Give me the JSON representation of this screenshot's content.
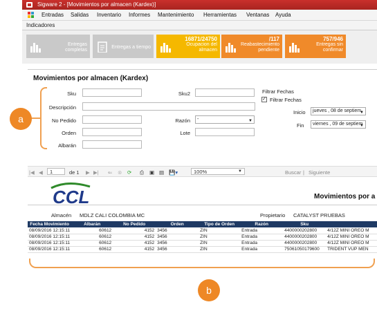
{
  "window": {
    "title": "Sigware 2 - [Movimientos por almacen (Kardex)]"
  },
  "menu": [
    "Entradas",
    "Salidas",
    "Inventario",
    "Informes",
    "Mantenimiento",
    "Herramientas",
    "Ventanas",
    "Ayuda"
  ],
  "subbar": {
    "label": "Indicadores"
  },
  "tiles": [
    {
      "num": "",
      "label1": "Entregas",
      "label2": "completas",
      "color": "#c9c9c9"
    },
    {
      "num": "",
      "label1": "Entregas a tiempo",
      "label2": "",
      "color": "#c9c9c9"
    },
    {
      "num": "16871/24750",
      "label1": "Ocupacion del",
      "label2": "almacen",
      "color": "#f5b800"
    },
    {
      "num": "/117",
      "label1": "Reabastecimiento",
      "label2": "pendiente",
      "color": "#f08a2a"
    },
    {
      "num": "757/946",
      "label1": "Entregas sin",
      "label2": "confirmar",
      "color": "#f08a2a"
    }
  ],
  "form": {
    "title": "Movimientos por almacen (Kardex)",
    "sku_label": "Sku",
    "sku2_label": "Sku2",
    "descripcion_label": "Descripción",
    "nopedido_label": "No Pedido",
    "razon_label": "Razón",
    "razon_value": "-",
    "orden_label": "Orden",
    "lote_label": "Lote",
    "albaran_label": "Albarán",
    "filter_group_label": "Filtrar Fechas",
    "filter_checkbox_label": "Filtrar Fechas",
    "inicio_label": "Inicio",
    "inicio_value": "jueves  , 08 de septiem",
    "fin_label": "Fin",
    "fin_value": "viernes  , 09 de septiem"
  },
  "toolbar": {
    "page": "1",
    "of_label": "de 1",
    "zoom": "100%",
    "buscar": "Buscar",
    "siguiente": "Siguiente"
  },
  "report": {
    "logo": "CCL",
    "heading": "Movimientos por a",
    "almacen_label": "Almacén",
    "almacen_value": "MDLZ CALI COLOMBIA MC",
    "propietario_label": "Propietario",
    "propietario_value": "CATALYST PRUEBAS",
    "columns": [
      "Fecha Movimiento",
      "Albarán",
      "No Pedido",
      "Orden",
      "Tipo de Orden",
      "Razón",
      "Sku",
      ""
    ],
    "rows": [
      [
        "08/09/2016 12:15:11",
        "60612",
        "4152",
        "3456",
        "ZIN",
        "Entrada",
        "4400000202800",
        "4/12Z MINI OREO M"
      ],
      [
        "08/09/2016 12:15:11",
        "60612",
        "4152",
        "3456",
        "ZIN",
        "Entrada",
        "4400000202800",
        "4/12Z MINI OREO M"
      ],
      [
        "08/09/2016 12:15:11",
        "60612",
        "4152",
        "3456",
        "ZIN",
        "Entrada",
        "4400000202800",
        "4/12Z MINI OREO M"
      ],
      [
        "08/09/2016 12:15:11",
        "60612",
        "4152",
        "3456",
        "ZIN",
        "Entrada",
        "75061050179600",
        "TRIDENT VUP MEN"
      ]
    ]
  },
  "callouts": {
    "a": "a",
    "b": "b"
  }
}
